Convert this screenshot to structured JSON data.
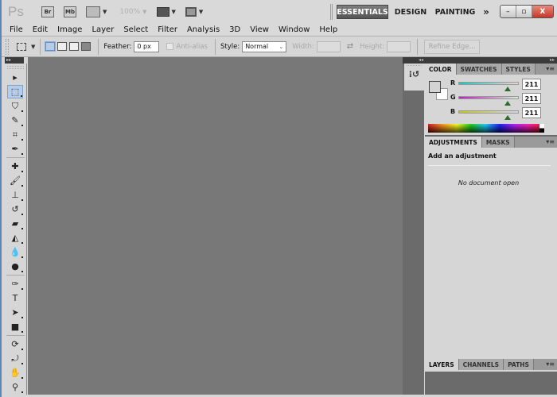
{
  "app": {
    "logo": "Ps",
    "bridge_label": "Br",
    "minibridge_label": "Mb",
    "zoom_level": "100%"
  },
  "workspaces": {
    "items": [
      "ESSENTIALS",
      "DESIGN",
      "PAINTING"
    ],
    "active": "ESSENTIALS",
    "more": "»"
  },
  "window_controls": {
    "minimize": "–",
    "restore": "▫",
    "close": "X"
  },
  "menu": [
    "File",
    "Edit",
    "Image",
    "Layer",
    "Select",
    "Filter",
    "Analysis",
    "3D",
    "View",
    "Window",
    "Help"
  ],
  "options": {
    "feather_label": "Feather:",
    "feather_value": "0 px",
    "antialias_label": "Anti-alias",
    "style_label": "Style:",
    "style_value": "Normal",
    "width_label": "Width:",
    "height_label": "Height:",
    "refine_edge": "Refine Edge..."
  },
  "tools": [
    {
      "name": "move-tool",
      "glyph": "▸"
    },
    {
      "name": "rectangular-marquee-tool",
      "glyph": "⬚",
      "selected": true
    },
    {
      "name": "lasso-tool",
      "glyph": "⛉"
    },
    {
      "name": "quick-selection-tool",
      "glyph": "✎"
    },
    {
      "name": "crop-tool",
      "glyph": "⌗"
    },
    {
      "name": "eyedropper-tool",
      "glyph": "✒"
    },
    {
      "name": "spot-healing-tool",
      "glyph": "✚"
    },
    {
      "name": "brush-tool",
      "glyph": "🖌"
    },
    {
      "name": "clone-stamp-tool",
      "glyph": "⊥"
    },
    {
      "name": "history-brush-tool",
      "glyph": "↺"
    },
    {
      "name": "eraser-tool",
      "glyph": "▰"
    },
    {
      "name": "paint-bucket-tool",
      "glyph": "◭"
    },
    {
      "name": "blur-tool",
      "glyph": "💧"
    },
    {
      "name": "dodge-tool",
      "glyph": "●"
    },
    {
      "name": "pen-tool",
      "glyph": "✑"
    },
    {
      "name": "type-tool",
      "glyph": "T"
    },
    {
      "name": "path-selection-tool",
      "glyph": "➤"
    },
    {
      "name": "rectangle-tool",
      "glyph": "■"
    },
    {
      "name": "3d-rotate-tool",
      "glyph": "⟳"
    },
    {
      "name": "3d-orbit-tool",
      "glyph": "⤾"
    },
    {
      "name": "hand-tool",
      "glyph": "✋"
    },
    {
      "name": "zoom-tool",
      "glyph": "⚲"
    }
  ],
  "color_panel": {
    "tabs": [
      "COLOR",
      "SWATCHES",
      "STYLES"
    ],
    "active_tab": "COLOR",
    "channels": [
      {
        "label": "R",
        "value": "211",
        "gradient": [
          "#19c5c5",
          "#f0d3d3"
        ]
      },
      {
        "label": "G",
        "value": "211",
        "gradient": [
          "#c519c5",
          "#d3f0d3"
        ]
      },
      {
        "label": "B",
        "value": "211",
        "gradient": [
          "#c5c519",
          "#d3d3f0"
        ]
      }
    ]
  },
  "adjustments_panel": {
    "tabs": [
      "ADJUSTMENTS",
      "MASKS"
    ],
    "active_tab": "ADJUSTMENTS",
    "title": "Add an adjustment",
    "message": "No document open"
  },
  "layers_panel": {
    "tabs": [
      "LAYERS",
      "CHANNELS",
      "PATHS"
    ],
    "active_tab": "LAYERS"
  }
}
